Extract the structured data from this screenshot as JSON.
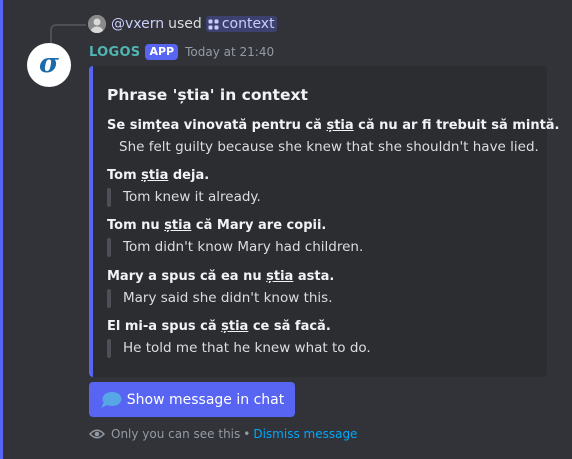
{
  "colors": {
    "accent": "#5865f2",
    "background": "#313338",
    "embed_bg": "#2b2d31",
    "link": "#00a8fc",
    "botname": "#4fb6b3"
  },
  "reply": {
    "username": "@vxern",
    "used_text": "used",
    "command": "context"
  },
  "message": {
    "avatar_glyph": "σ",
    "bot_name": "LOGOS",
    "app_badge": "APP",
    "timestamp": "Today at 21:40"
  },
  "embed": {
    "title": "Phrase 'știa' in context",
    "examples": [
      {
        "ro_before": "Se simțea vinovată pentru că ",
        "ro_highlight": "știa",
        "ro_after": " că nu ar fi trebuit să mintă.",
        "en": "She felt guilty because she knew that she shouldn't have lied."
      },
      {
        "ro_before": "Tom ",
        "ro_highlight": "știa",
        "ro_after": " deja.",
        "en": "Tom knew it already."
      },
      {
        "ro_before": "Tom nu ",
        "ro_highlight": "știa",
        "ro_after": " că Mary are copii.",
        "en": "Tom didn't know Mary had children."
      },
      {
        "ro_before": "Mary a spus că ea nu ",
        "ro_highlight": "știa",
        "ro_after": " asta.",
        "en": "Mary said she didn't know this."
      },
      {
        "ro_before": "El mi-a spus că ",
        "ro_highlight": "știa",
        "ro_after": " ce să facă.",
        "en": "He told me that he knew what to do."
      }
    ]
  },
  "button": {
    "label": "Show message in chat",
    "icon": "chat-bubble-icon"
  },
  "ephemeral": {
    "icon": "eye-icon",
    "notice": "Only you can see this",
    "separator": "•",
    "dismiss_label": "Dismiss message"
  }
}
